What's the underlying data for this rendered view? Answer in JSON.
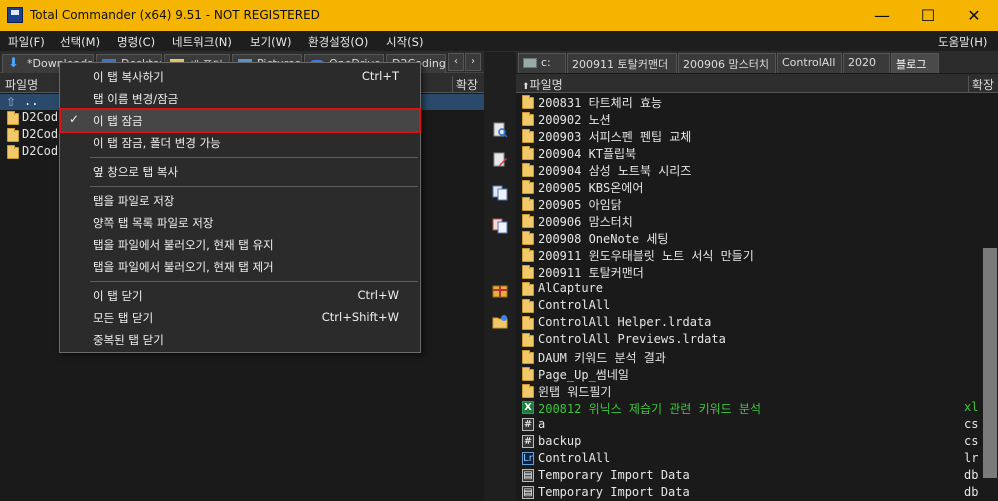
{
  "window": {
    "title": "Total Commander (x64) 9.51 - NOT REGISTERED",
    "minimize_glyph": "—",
    "maximize_glyph": "☐",
    "close_glyph": "✕"
  },
  "menubar": {
    "items": [
      "파일(F)",
      "선택(M)",
      "명령(C)",
      "네트워크(N)",
      "보기(W)",
      "환경설정(O)",
      "시작(S)"
    ],
    "help": "도움말(H)"
  },
  "left_panel": {
    "tabs": [
      "*Downloads",
      "Desktop",
      "새 폴더",
      "Pictures",
      "OneDrive",
      "D2Coding"
    ],
    "tab_nav_prev": "‹",
    "tab_nav_next": "›",
    "col_name": "파일명",
    "col_ext": "확장",
    "updir_arrow": "⇧",
    "updir_label": "..",
    "rows": [
      "D2Cod",
      "D2Cod",
      "D2Cod"
    ]
  },
  "context_menu": {
    "items": [
      {
        "label": "이 탭 복사하기",
        "shortcut": "Ctrl+T"
      },
      {
        "label": "탭 이름 변경/잠금",
        "shortcut": ""
      },
      {
        "label": "이 탭 잠금",
        "shortcut": "",
        "checked": true,
        "highlighted": true
      },
      {
        "label": "이 탭 잠금, 폴더 변경 가능",
        "shortcut": ""
      },
      {
        "label": "옆 창으로 탭 복사",
        "shortcut": ""
      },
      {
        "label": "탭을 파일로 저장",
        "shortcut": ""
      },
      {
        "label": "양쪽 탭 목록 파일로 저장",
        "shortcut": ""
      },
      {
        "label": "탭을 파일에서 불러오기, 현재 탭 유지",
        "shortcut": ""
      },
      {
        "label": "탭을 파일에서 불러오기, 현재 탭 제거",
        "shortcut": ""
      },
      {
        "label": "이 탭 닫기",
        "shortcut": "Ctrl+W"
      },
      {
        "label": "모든 탭 닫기",
        "shortcut": "Ctrl+Shift+W"
      },
      {
        "label": "중복된 탭 닫기",
        "shortcut": ""
      }
    ],
    "check_glyph": "✓"
  },
  "right_panel": {
    "drive": "c:",
    "tabs": [
      "200911 토탈커맨더",
      "200906 맘스터치",
      "ControlAll",
      "2020",
      "블로그"
    ],
    "active_tab": "블로그",
    "col_name": "파일명",
    "col_ext": "확장",
    "rows": [
      {
        "name": "200831 타트체리 효능",
        "type": "folder",
        "ext": ""
      },
      {
        "name": "200902 노션",
        "type": "folder",
        "ext": ""
      },
      {
        "name": "200903 서피스펜 펜팁 교체",
        "type": "folder",
        "ext": ""
      },
      {
        "name": "200904 KT플립북",
        "type": "folder",
        "ext": ""
      },
      {
        "name": "200904 삼성 노트북 시리즈",
        "type": "folder",
        "ext": ""
      },
      {
        "name": "200905 KBS온에어",
        "type": "folder",
        "ext": ""
      },
      {
        "name": "200905 아임닭",
        "type": "folder",
        "ext": ""
      },
      {
        "name": "200906 맘스터치",
        "type": "folder",
        "ext": ""
      },
      {
        "name": "200908 OneNote 세팅",
        "type": "folder",
        "ext": ""
      },
      {
        "name": "200911 윈도우태블릿 노트 서식 만들기",
        "type": "folder",
        "ext": ""
      },
      {
        "name": "200911 토탈커맨더",
        "type": "folder",
        "ext": ""
      },
      {
        "name": "AlCapture",
        "type": "folder",
        "ext": ""
      },
      {
        "name": "ControlAll",
        "type": "folder",
        "ext": ""
      },
      {
        "name": "ControlAll Helper.lrdata",
        "type": "folder",
        "ext": ""
      },
      {
        "name": "ControlAll Previews.lrdata",
        "type": "folder",
        "ext": ""
      },
      {
        "name": "DAUM 키워드 분석 결과",
        "type": "folder",
        "ext": ""
      },
      {
        "name": "Page_Up_썸네일",
        "type": "folder",
        "ext": ""
      },
      {
        "name": "윈탭 워드필기",
        "type": "folder",
        "ext": ""
      },
      {
        "name": "200812 위닉스 제습기 관련 키워드 분석",
        "type": "excel",
        "ext": "xl",
        "green": true,
        "icon_text": "X"
      },
      {
        "name": "a",
        "type": "generic",
        "ext": "cs",
        "icon_text": "#"
      },
      {
        "name": "backup",
        "type": "generic",
        "ext": "cs",
        "icon_text": "#"
      },
      {
        "name": "ControlAll",
        "type": "lightroom",
        "ext": "lr",
        "icon_text": "Lr"
      },
      {
        "name": "Temporary Import Data",
        "type": "generic",
        "ext": "db",
        "icon_text": "▤"
      },
      {
        "name": "Temporary Import Data",
        "type": "generic",
        "ext": "db",
        "icon_text": "▤"
      }
    ]
  }
}
